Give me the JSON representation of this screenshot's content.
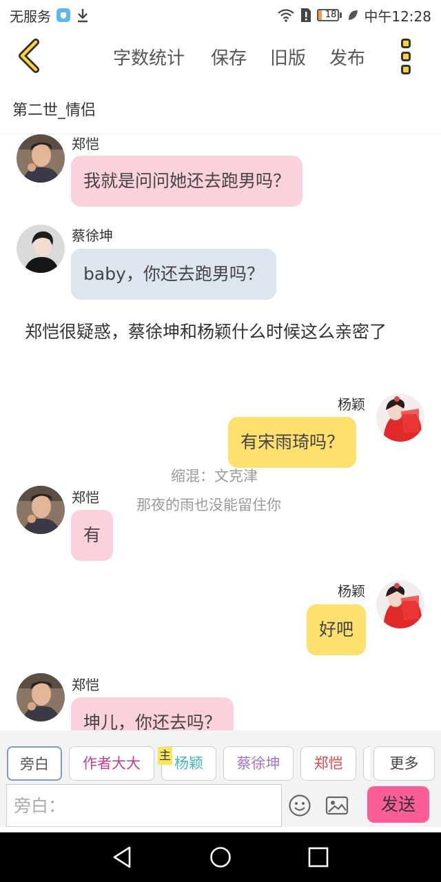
{
  "status": {
    "carrier": "无服务",
    "battery": "18",
    "battery_level": 0.18,
    "time": "中午12:28",
    "battery_color": "#f39c4a"
  },
  "toolbar": {
    "menu": [
      "字数统计",
      "保存",
      "旧版",
      "发布"
    ],
    "back_icon": "chevron-left-icon",
    "more_icon": "more-vertical-icon",
    "accent": "#ffd23c"
  },
  "chapter_title": "第二世_情侣",
  "messages": [
    {
      "sender": "郑恺",
      "text": "我就是问问她还去跑男吗？"
    },
    {
      "sender": "蔡徐坤",
      "text": "baby，你还去跑男吗？"
    },
    {
      "narration": "郑恺很疑惑，蔡徐坤和杨颖什么时候这么亲密了"
    },
    {
      "sender": "杨颖",
      "text": "有宋雨琦吗？"
    },
    {
      "sender": "郑恺",
      "text": "有"
    },
    {
      "sender": "杨颖",
      "text": "好吧"
    },
    {
      "sender": "郑恺",
      "text": "坤儿，你还去吗？"
    }
  ],
  "watermark": {
    "line1": "缩混：文克津",
    "line2": "那夜的雨也没能留住你"
  },
  "roles": {
    "items": [
      "旁白",
      "作者大大",
      "杨颖",
      "蔡徐坤",
      "郑恺",
      "更多"
    ],
    "main_tag": "主",
    "colors": {
      "author": "#c83c8c",
      "yangying": "#48b4b4",
      "caixukun": "#a872c8",
      "zhengkai": "#e0454d"
    }
  },
  "composer": {
    "placeholder": "旁白：",
    "emoji_icon": "smiley-icon",
    "image_icon": "image-icon",
    "send_label": "发送",
    "send_color": "#fb5d96"
  },
  "bubble_colors": {
    "zhengkai": "#fbd1dc",
    "caixukun": "#dde5ef",
    "yangying": "#fde06e"
  }
}
